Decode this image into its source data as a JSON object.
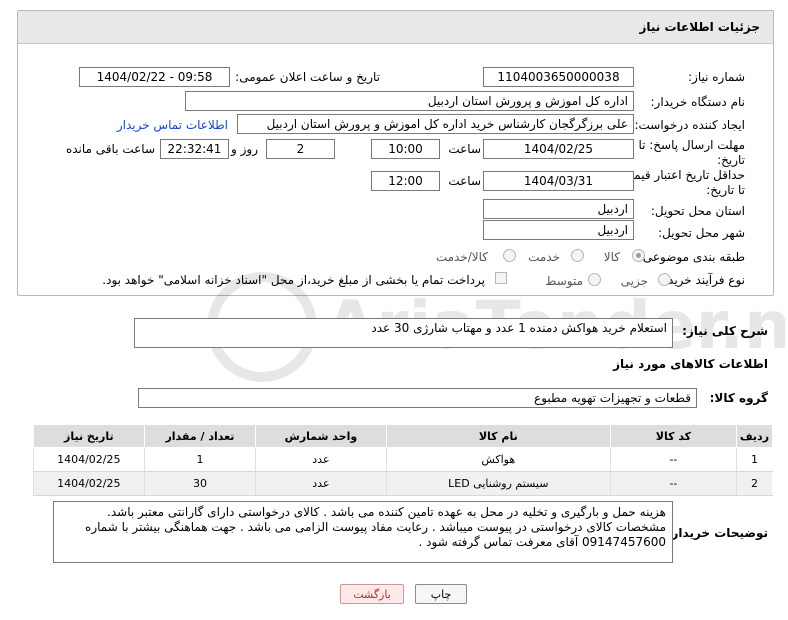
{
  "header": {
    "title": "جزئیات اطلاعات نیاز"
  },
  "fields": {
    "need_number_label": "شماره نیاز:",
    "need_number": "1104003650000038",
    "announce_label": "تاریخ و ساعت اعلان عمومی:",
    "announce_value": "1404/02/22 - 09:58",
    "buyer_org_label": "نام دستگاه خریدار:",
    "buyer_org": "اداره کل اموزش و پرورش استان اردبیل",
    "creator_label": "ایجاد کننده درخواست:",
    "creator": "علی برزگرگجان کارشناس خرید اداره کل اموزش و پرورش استان اردبیل",
    "contact_link": "اطلاعات تماس خریدار",
    "deadline_label_1": "مهلت ارسال پاسخ: تا",
    "deadline_label_2": "تاریخ:",
    "deadline_date": "1404/02/25",
    "time_label": "ساعت",
    "deadline_time": "10:00",
    "days_value": "2",
    "days_label": "روز و",
    "remaining_value": "22:32:41",
    "remaining_label": "ساعت باقی مانده",
    "validity_label_1": "حداقل تاریخ اعتبار قیمت:",
    "validity_label_2": "تا تاریخ:",
    "validity_date": "1404/03/31",
    "validity_time": "12:00",
    "province_label": "استان محل تحویل:",
    "province": "اردبیل",
    "city_label": "شهر محل تحویل:",
    "city": "اردبیل",
    "category_label": "طبقه بندی موضوعی:",
    "category_options": [
      "کالا",
      "خدمت",
      "کالا/خدمت"
    ],
    "category_selected": "کالا",
    "process_label": "نوع فرآیند خرید :",
    "process_options": [
      "جزیی",
      "متوسط"
    ],
    "payment_note": "پرداخت تمام یا بخشی از مبلغ خرید،از محل \"اسناد خزانه اسلامی\" خواهد بود."
  },
  "summary": {
    "label": "شرح کلی نیاز:",
    "value": "استعلام خرید هواکش دمنده 1 عدد و مهتاب شارژی 30 عدد"
  },
  "goods": {
    "heading": "اطلاعات کالاهای مورد نیاز",
    "group_label": "گروه کالا:",
    "group_value": "قطعات و تجهیزات تهویه مطبوع",
    "columns": [
      "ردیف",
      "کد کالا",
      "نام کالا",
      "واحد شمارش",
      "تعداد / مقدار",
      "تاریخ نیاز"
    ],
    "rows": [
      {
        "row": "1",
        "code": "--",
        "name": "هواکش",
        "unit": "عدد",
        "qty": "1",
        "date": "1404/02/25"
      },
      {
        "row": "2",
        "code": "--",
        "name": "سیستم روشنایی LED",
        "unit": "عدد",
        "qty": "30",
        "date": "1404/02/25"
      }
    ]
  },
  "buyer_notes": {
    "label": "توضیحات خریدار:",
    "line1": "هزینه حمل و بارگیری و تخلیه در محل به عهده تامین کننده می باشد . کالای درخواستی دارای گارانتی معتبر باشد.",
    "line2": "مشخصات کالای درخواستی در پیوست میباشد . رعایت مفاد پیوست الزامی می باشد . جهت هماهنگی بیشتر با شماره",
    "line3": "09147457600 آقای معرفت تماس گرفته شود ."
  },
  "buttons": {
    "print": "چاپ",
    "back": "بازگشت"
  },
  "watermark": {
    "text": "AriaTender.net"
  },
  "colors": {
    "link": "#1a44d6",
    "header_bg": "#e8e8e8",
    "back_button_bg": "#fde9e9"
  }
}
